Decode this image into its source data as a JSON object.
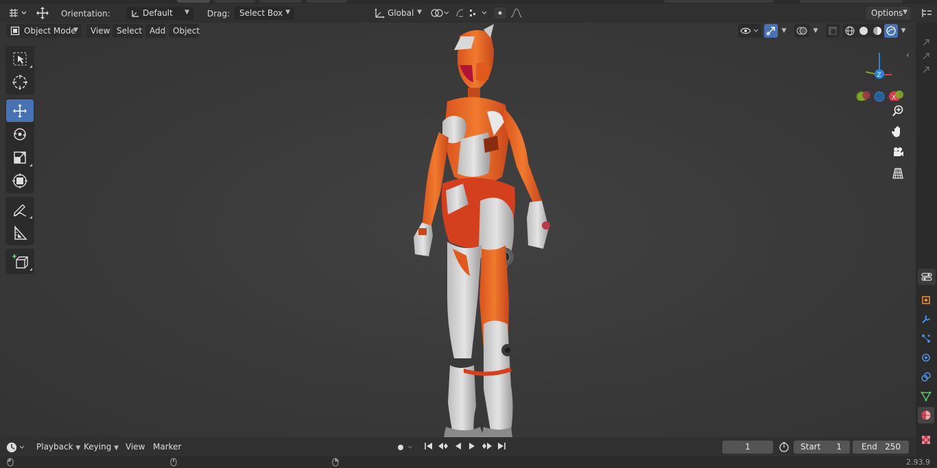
{
  "tool_header": {
    "orientation_label": "Orientation:",
    "orientation_value": "Default",
    "drag_label": "Drag:",
    "drag_value": "Select Box",
    "transform_orientation": "Global",
    "options_label": "Options"
  },
  "viewport_header": {
    "mode": "Object Mode",
    "menus": [
      "View",
      "Select",
      "Add",
      "Object"
    ]
  },
  "toolbar": {
    "tools": [
      "select-box",
      "cursor",
      "move",
      "rotate",
      "scale",
      "transform",
      "annotate",
      "measure",
      "add-cube"
    ],
    "active": "move"
  },
  "gizmo": {
    "z_label": "Z",
    "x_label": "X"
  },
  "timeline": {
    "menus": [
      "Playback",
      "Keying",
      "View",
      "Marker"
    ],
    "current_frame": "1",
    "start_label": "Start",
    "start_value": "1",
    "end_label": "End",
    "end_value": "250"
  },
  "status": {
    "version": "2.93.9"
  },
  "colors": {
    "accent": "#4772b3",
    "axis_x": "#e0384b",
    "axis_y": "#7ea82a",
    "axis_z": "#2d82d8"
  }
}
